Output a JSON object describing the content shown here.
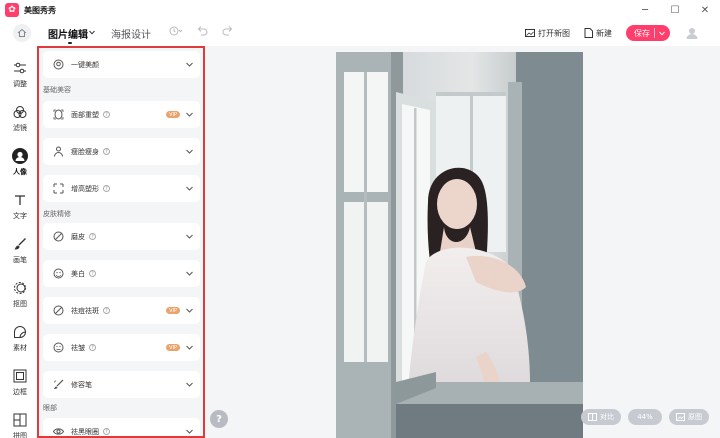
{
  "app": {
    "title": "美图秀秀"
  },
  "window_controls": {
    "minimize": "─",
    "maximize": "☐",
    "close": "✕"
  },
  "toolbar": {
    "tabs": [
      {
        "label": "图片编辑",
        "active": true
      },
      {
        "label": "海报设计",
        "active": false
      }
    ],
    "open_image_label": "打开新图",
    "new_label": "新建",
    "save_label": "保存"
  },
  "rail": {
    "items": [
      {
        "label": "调整",
        "icon": "sliders-icon"
      },
      {
        "label": "滤镜",
        "icon": "filter-icon"
      },
      {
        "label": "人像",
        "icon": "portrait-icon",
        "active": true
      },
      {
        "label": "文字",
        "icon": "text-icon"
      },
      {
        "label": "画笔",
        "icon": "brush-icon"
      },
      {
        "label": "抠图",
        "icon": "cutout-icon"
      },
      {
        "label": "素材",
        "icon": "sticker-icon"
      },
      {
        "label": "边框",
        "icon": "frame-icon"
      },
      {
        "label": "拼图",
        "icon": "collage-icon"
      }
    ]
  },
  "panel": {
    "one_click": {
      "label": "一键美颜"
    },
    "sections": {
      "basic": "基础美容",
      "skin": "皮肤精修",
      "eyes": "眼部"
    },
    "items": {
      "face_rebuild": {
        "label": "面部重塑",
        "badge": "VIP"
      },
      "slim": {
        "label": "瘦脸瘦身"
      },
      "height": {
        "label": "增高塑形"
      },
      "smooth": {
        "label": "磨皮"
      },
      "whiten": {
        "label": "美白"
      },
      "acne": {
        "label": "祛痘祛斑",
        "badge": "VIP"
      },
      "wrinkle": {
        "label": "祛皱",
        "badge": "VIP"
      },
      "concealer": {
        "label": "修容笔"
      },
      "dark_circles": {
        "label": "祛黑眼圈"
      }
    },
    "help_glyph": "?"
  },
  "canvas": {
    "compare_label": "对比",
    "zoom": "44%",
    "view_label": "原图"
  },
  "colors": {
    "accent": "#ff3e6c",
    "panel_highlight": "#e03b3b",
    "vip": "#e9a36b"
  }
}
